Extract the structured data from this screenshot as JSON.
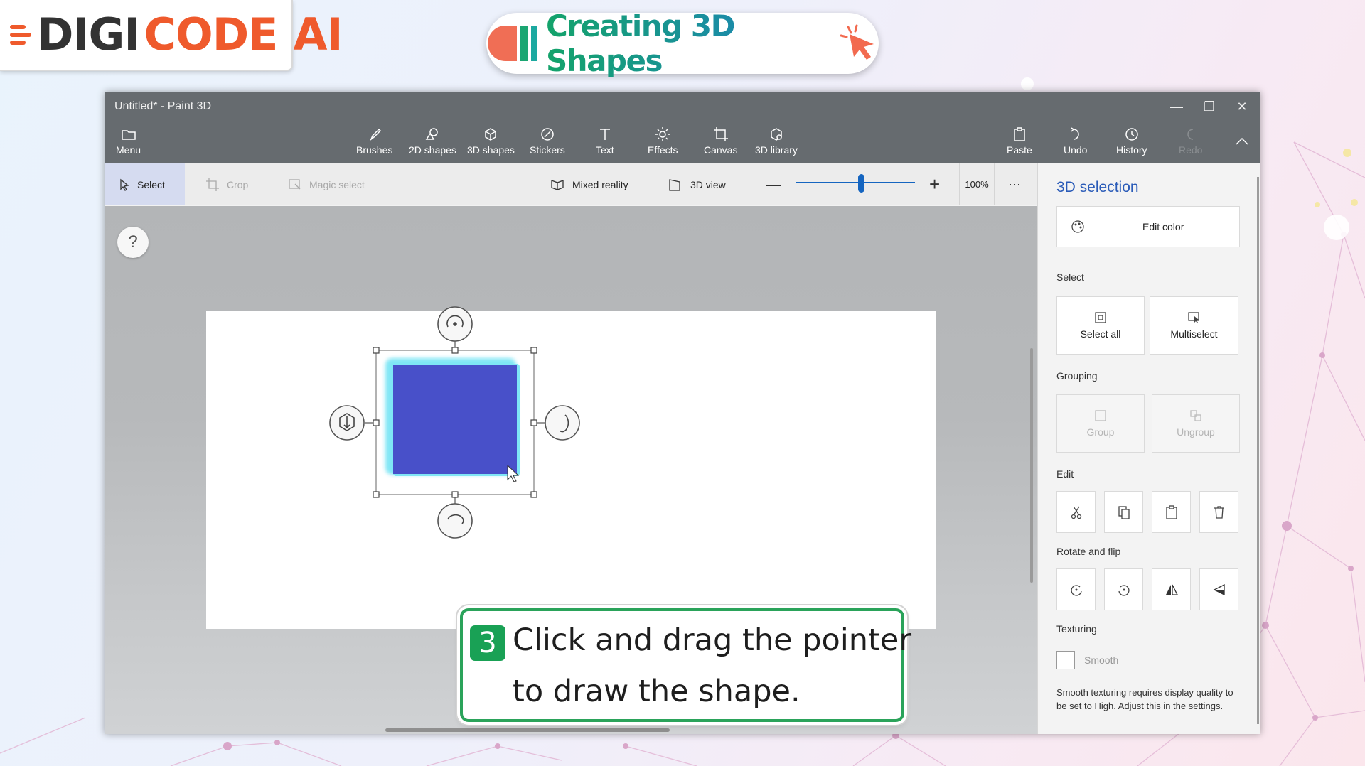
{
  "brand": {
    "part1": "DIGI",
    "part2": "CODE",
    "part3": "AI"
  },
  "lesson_title": "Creating 3D Shapes",
  "window": {
    "title": "Untitled* - Paint 3D"
  },
  "ribbon": {
    "menu": "Menu",
    "tools": [
      "Brushes",
      "2D shapes",
      "3D shapes",
      "Stickers",
      "Text",
      "Effects",
      "Canvas",
      "3D library"
    ],
    "paste": "Paste",
    "undo": "Undo",
    "history": "History",
    "redo": "Redo"
  },
  "toolbar": {
    "select": "Select",
    "crop": "Crop",
    "magic_select": "Magic select",
    "mixed_reality": "Mixed reality",
    "view_3d": "3D view",
    "zoom": "100%",
    "zoom_level": 0.55,
    "more": "···"
  },
  "help": "?",
  "panel": {
    "title": "3D selection",
    "edit_color": "Edit color",
    "select_label": "Select",
    "select_all": "Select all",
    "multiselect": "Multiselect",
    "grouping_label": "Grouping",
    "group": "Group",
    "ungroup": "Ungroup",
    "edit_label": "Edit",
    "rotate_label": "Rotate and flip",
    "texturing_label": "Texturing",
    "smooth": "Smooth",
    "note": "Smooth texturing requires display quality to be set to High. Adjust this in the settings."
  },
  "shape": {
    "fill": "#4850c9",
    "glow": "#7fe6f5"
  },
  "callout": {
    "step": "3",
    "line1": "Click and drag the pointer",
    "line2": "to draw the shape."
  }
}
